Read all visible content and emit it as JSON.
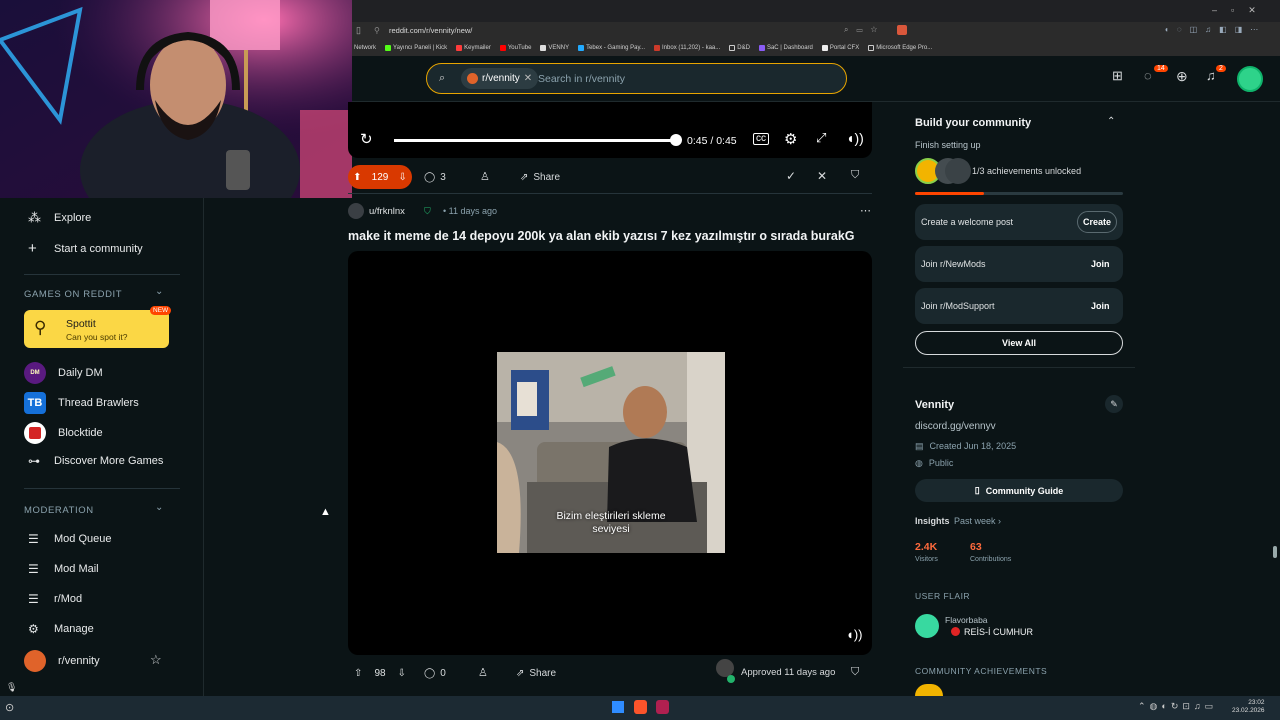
{
  "browser": {
    "url": "reddit.com/r/vennity/new/",
    "bookmarks": [
      "Network",
      "Yayıncı Paneli | Kick",
      "Keymailer",
      "YouTube",
      "VENNY",
      "Tebex - Gaming Pay...",
      "Inbox (11,202) - kaa...",
      "D&D",
      "SaC | Dashboard",
      "Portal CFX",
      "Microsoft Edge Pro..."
    ]
  },
  "header": {
    "search_chip": "r/vennity",
    "search_placeholder": "Search in r/vennity",
    "chat_badge": "14",
    "notif_badge": "2"
  },
  "sidebar": {
    "explore": "Explore",
    "start_community": "Start a community",
    "games_heading": "GAMES ON REDDIT",
    "spottit_title": "Spottit",
    "spottit_sub": "Can you spot it?",
    "new_badge": "NEW",
    "games": [
      "Daily DM",
      "Thread Brawlers",
      "Blocktide",
      "Discover More Games"
    ],
    "moderation_heading": "MODERATION",
    "mod_items": [
      "Mod Queue",
      "Mod Mail",
      "r/Mod",
      "Manage",
      "r/vennity"
    ]
  },
  "player1": {
    "time": "0:45 / 0:45",
    "progress": 1.0
  },
  "post1": {
    "votes": "129",
    "comments": "3",
    "share": "Share"
  },
  "post2": {
    "author": "u/frknlnx",
    "age": "11 days ago",
    "title": "make it meme de 14 depoyu 200k ya alan ekib yazısı 7 kez yazılmıştır o sırada burakG",
    "caption_line1": "Bizim eleştirileri skleme",
    "caption_line2": "seviyesi",
    "votes": "98",
    "comments": "0",
    "share": "Share",
    "approved": "Approved 11 days ago"
  },
  "right": {
    "build_title": "Build your community",
    "finish": "Finish setting up",
    "achievements": "1/3 achievements unlocked",
    "achievement_progress": 0.33,
    "tasks": [
      {
        "label": "Create a welcome post",
        "action": "Create"
      },
      {
        "label": "Join r/NewMods",
        "action": "Join"
      },
      {
        "label": "Join r/ModSupport",
        "action": "Join"
      }
    ],
    "view_all": "View All",
    "community_name": "Vennity",
    "community_desc": "discord.gg/vennyv",
    "created": "Created Jun 18, 2025",
    "visibility": "Public",
    "guide": "Community Guide",
    "insights": "Insights",
    "insights_period": "Past week",
    "visitors_value": "2.4K",
    "visitors_label": "Visitors",
    "contrib_value": "63",
    "contrib_label": "Contributions",
    "user_flair_heading": "USER FLAIR",
    "flair_user": "Flavorbaba",
    "flair_text": "REİS-İ CUMHUR",
    "achievements_heading": "COMMUNITY ACHIEVEMENTS"
  },
  "taskbar": {
    "time": "23:02",
    "date": "23.02.2026"
  },
  "colors": {
    "accent": "#ff4500",
    "vote_up": "#d93900",
    "search_border": "#e8a500",
    "link_blue": "#82b6ff"
  }
}
